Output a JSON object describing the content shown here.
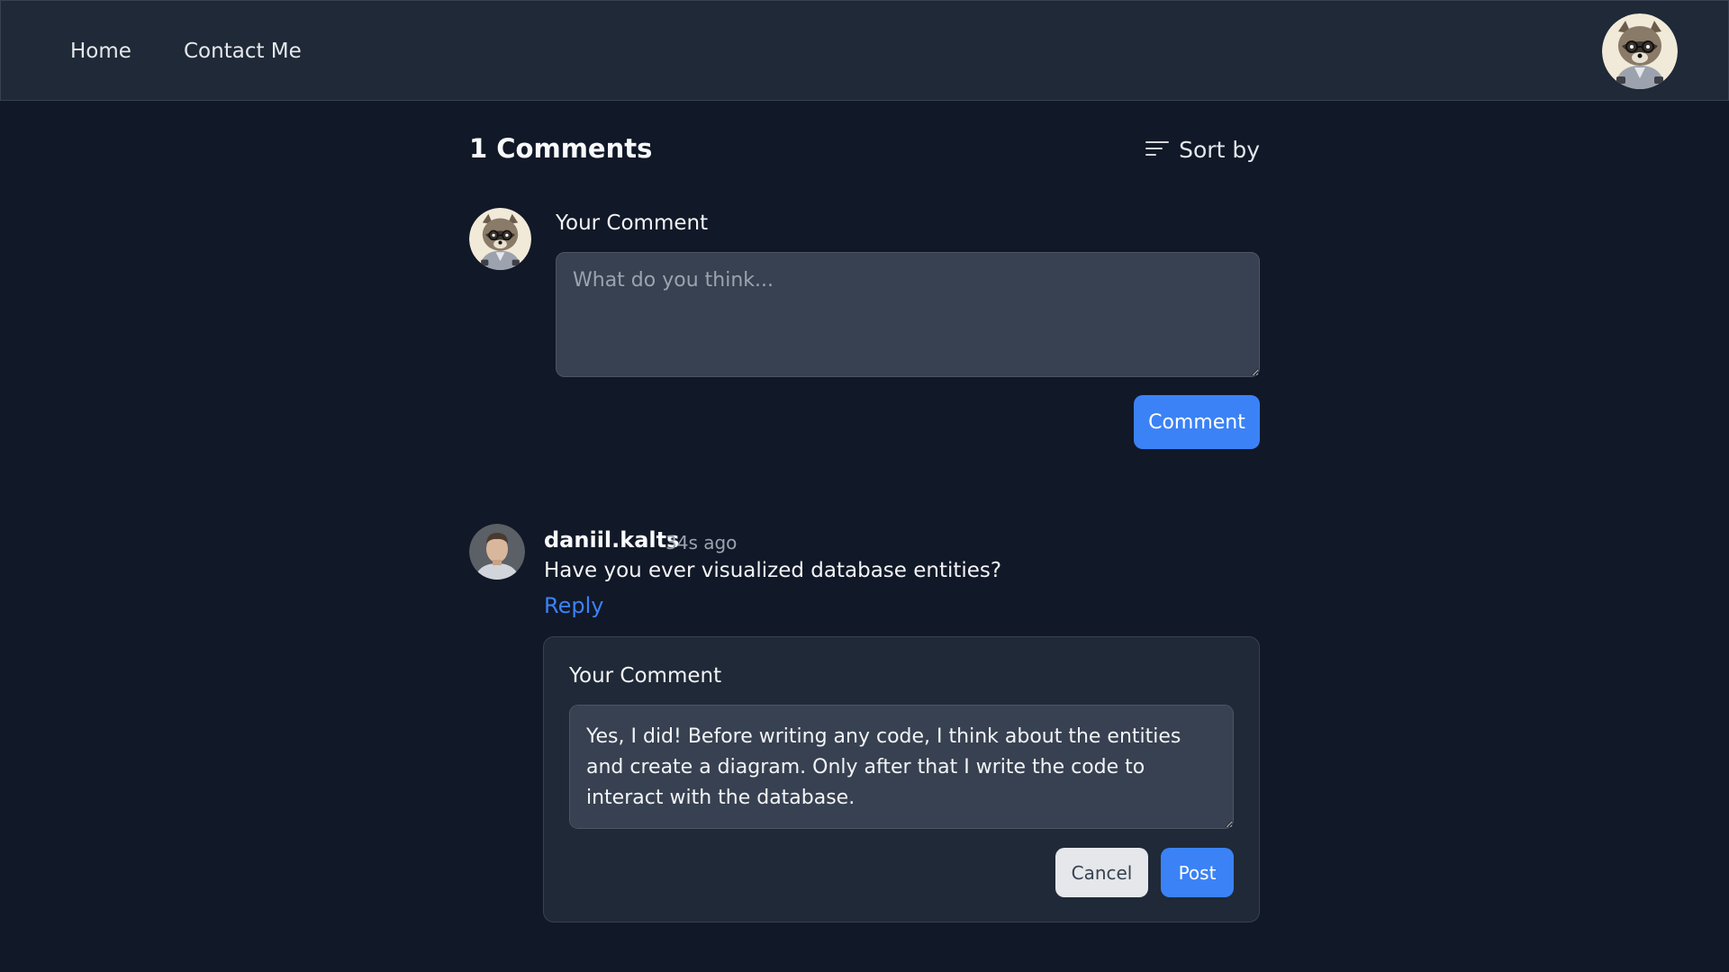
{
  "nav": {
    "home_label": "Home",
    "contact_label": "Contact Me",
    "avatar_icon": "raccoon-avatar-icon"
  },
  "comments": {
    "title": "1 Comments",
    "sort_label": "Sort by",
    "sort_icon": "sort-lines-icon"
  },
  "composer": {
    "label": "Your Comment",
    "placeholder": "What do you think...",
    "submit_label": "Comment"
  },
  "comment": {
    "author": "daniil.kalts",
    "time": "34s ago",
    "text": "Have you ever visualized database entities?",
    "reply_label": "Reply"
  },
  "reply": {
    "label": "Your Comment",
    "value": "Yes, I did! Before writing any code, I think about the entities and create a diagram. Only after that I write the code to interact with the database.",
    "cancel_label": "Cancel",
    "post_label": "Post"
  },
  "colors": {
    "background": "#111827",
    "navbar": "#1f2937",
    "accent": "#3b82f6",
    "input": "#374151"
  }
}
